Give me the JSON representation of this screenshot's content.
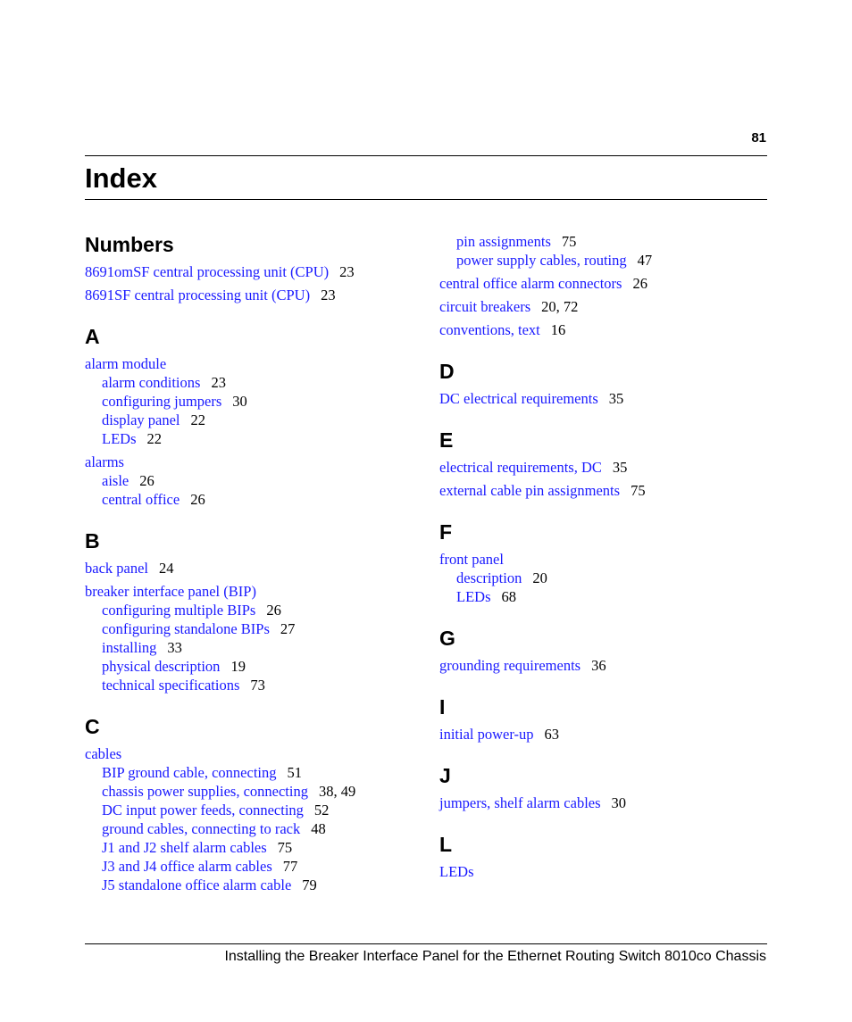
{
  "header": {
    "page_number": "81",
    "title": "Index"
  },
  "footer": {
    "text": "Installing the Breaker Interface Panel for the Ethernet Routing Switch 8010co Chassis"
  },
  "colors": {
    "link": "#1a1aff",
    "text": "#000000"
  },
  "left_column": [
    {
      "heading": "Numbers",
      "entries": [
        {
          "term": "8691omSF central processing unit (CPU)",
          "pages": "23",
          "subs": []
        },
        {
          "term": "8691SF central processing unit (CPU)",
          "pages": "23",
          "subs": []
        }
      ]
    },
    {
      "heading": "A",
      "entries": [
        {
          "term": "alarm module",
          "pages": "",
          "subs": [
            {
              "term": "alarm conditions",
              "pages": "23"
            },
            {
              "term": "configuring jumpers",
              "pages": "30"
            },
            {
              "term": "display panel",
              "pages": "22"
            },
            {
              "term": "LEDs",
              "pages": "22"
            }
          ]
        },
        {
          "term": "alarms",
          "pages": "",
          "subs": [
            {
              "term": "aisle",
              "pages": "26"
            },
            {
              "term": "central office",
              "pages": "26"
            }
          ]
        }
      ]
    },
    {
      "heading": "B",
      "entries": [
        {
          "term": "back panel",
          "pages": "24",
          "subs": []
        },
        {
          "term": "breaker interface panel (BIP)",
          "pages": "",
          "subs": [
            {
              "term": "configuring multiple BIPs",
              "pages": "26"
            },
            {
              "term": "configuring standalone BIPs",
              "pages": "27"
            },
            {
              "term": "installing",
              "pages": "33"
            },
            {
              "term": "physical description",
              "pages": "19"
            },
            {
              "term": "technical specifications",
              "pages": "73"
            }
          ]
        }
      ]
    },
    {
      "heading": "C",
      "entries": [
        {
          "term": "cables",
          "pages": "",
          "subs": [
            {
              "term": "BIP ground cable, connecting",
              "pages": "51"
            },
            {
              "term": "chassis power supplies, connecting",
              "pages": "38, 49"
            },
            {
              "term": "DC input power feeds, connecting",
              "pages": "52"
            },
            {
              "term": "ground cables, connecting to rack",
              "pages": "48"
            },
            {
              "term": "J1 and J2 shelf alarm cables",
              "pages": "75"
            },
            {
              "term": "J3 and J4 office alarm cables",
              "pages": "77"
            },
            {
              "term": "J5 standalone office alarm cable",
              "pages": "79"
            }
          ]
        }
      ]
    }
  ],
  "right_column": [
    {
      "heading": "",
      "entries": [
        {
          "term": "",
          "pages": "",
          "subs": [
            {
              "term": "pin assignments",
              "pages": "75"
            },
            {
              "term": "power supply cables, routing",
              "pages": "47"
            }
          ]
        },
        {
          "term": "central office alarm connectors",
          "pages": "26",
          "subs": []
        },
        {
          "term": "circuit breakers",
          "pages": "20, 72",
          "subs": []
        },
        {
          "term": "conventions, text",
          "pages": "16",
          "subs": []
        }
      ]
    },
    {
      "heading": "D",
      "entries": [
        {
          "term": "DC electrical requirements",
          "pages": "35",
          "subs": []
        }
      ]
    },
    {
      "heading": "E",
      "entries": [
        {
          "term": "electrical requirements, DC",
          "pages": "35",
          "subs": []
        },
        {
          "term": "external cable pin assignments",
          "pages": "75",
          "subs": []
        }
      ]
    },
    {
      "heading": "F",
      "entries": [
        {
          "term": "front panel",
          "pages": "",
          "subs": [
            {
              "term": "description",
              "pages": "20"
            },
            {
              "term": "LEDs",
              "pages": "68"
            }
          ]
        }
      ]
    },
    {
      "heading": "G",
      "entries": [
        {
          "term": "grounding requirements",
          "pages": "36",
          "subs": []
        }
      ]
    },
    {
      "heading": "I",
      "entries": [
        {
          "term": "initial power-up",
          "pages": "63",
          "subs": []
        }
      ]
    },
    {
      "heading": "J",
      "entries": [
        {
          "term": "jumpers, shelf alarm cables",
          "pages": "30",
          "subs": []
        }
      ]
    },
    {
      "heading": "L",
      "entries": [
        {
          "term": "LEDs",
          "pages": "",
          "subs": []
        }
      ]
    }
  ]
}
